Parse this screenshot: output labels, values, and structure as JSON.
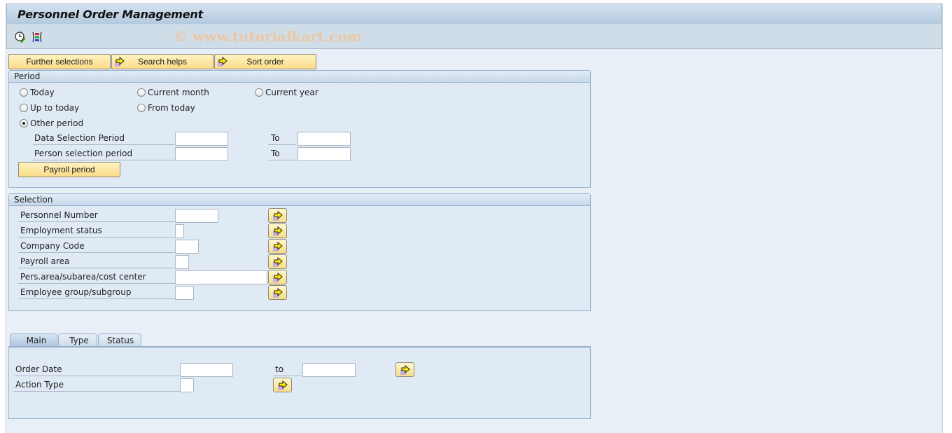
{
  "window": {
    "title": "Personnel Order Management",
    "watermark": "© www.tutorialkart.com"
  },
  "toolbar": {
    "icons": [
      "execute-clock-check-icon",
      "get-variant-icon"
    ]
  },
  "selection_buttons": {
    "further_selections": "Further selections",
    "search_helps": "Search helps",
    "sort_order": "Sort order"
  },
  "period": {
    "title": "Period",
    "radios": [
      {
        "label": "Today",
        "checked": false
      },
      {
        "label": "Current month",
        "checked": false
      },
      {
        "label": "Current year",
        "checked": false
      },
      {
        "label": "Up to today",
        "checked": false
      },
      {
        "label": "From today",
        "checked": false
      },
      {
        "label": "Other period",
        "checked": true
      }
    ],
    "fields": [
      {
        "label": "Data Selection Period",
        "from": "",
        "to_label": "To",
        "to": ""
      },
      {
        "label": "Person selection period",
        "from": "",
        "to_label": "To",
        "to": ""
      }
    ],
    "payroll_button": "Payroll period"
  },
  "selection": {
    "title": "Selection",
    "fields": [
      {
        "label": "Personnel Number",
        "value": ""
      },
      {
        "label": "Employment status",
        "value": ""
      },
      {
        "label": "Company Code",
        "value": ""
      },
      {
        "label": "Payroll area",
        "value": ""
      },
      {
        "label": "Pers.area/subarea/cost center",
        "value": ""
      },
      {
        "label": "Employee group/subgroup",
        "value": ""
      }
    ]
  },
  "tabs": {
    "items": [
      {
        "label": "Main",
        "active": true
      },
      {
        "label": "Type",
        "active": false
      },
      {
        "label": "Status",
        "active": false
      }
    ],
    "main": {
      "order_date": {
        "label": "Order Date",
        "from": "",
        "to_label": "to",
        "to": ""
      },
      "action_type": {
        "label": "Action Type",
        "value": ""
      }
    }
  }
}
